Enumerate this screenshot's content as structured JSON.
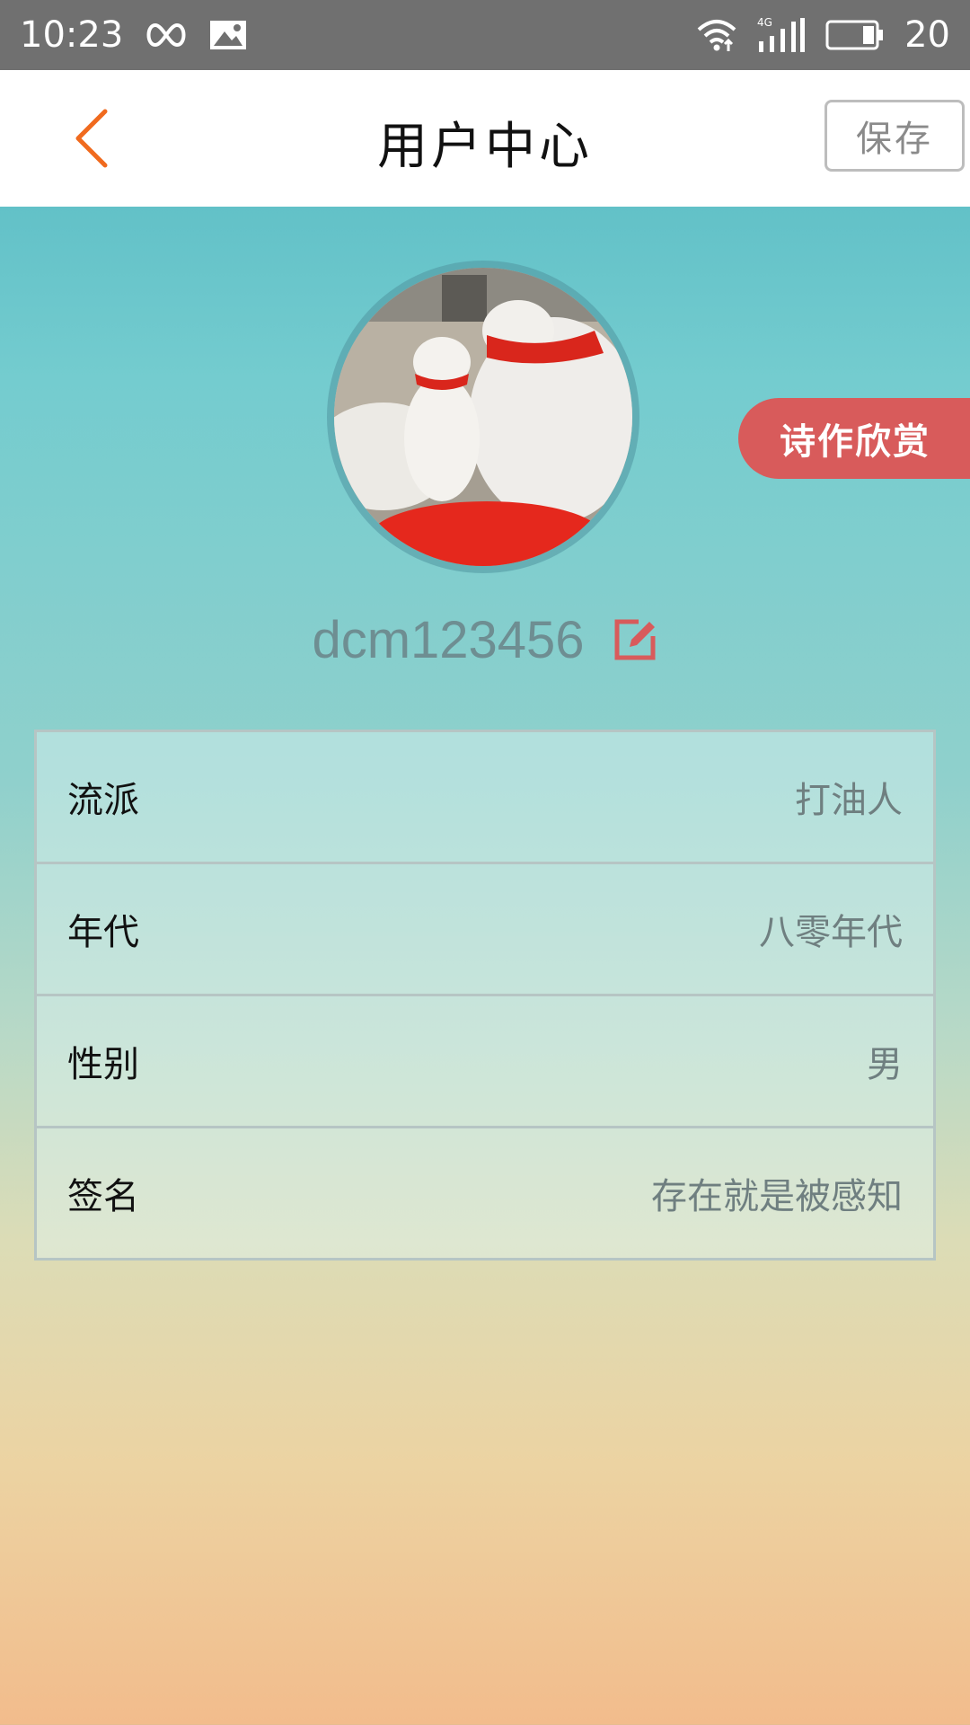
{
  "status_bar": {
    "time": "10:23",
    "battery_level": "20",
    "icons": [
      "infinity-icon",
      "image-icon",
      "wifi-icon",
      "signal-4g-icon",
      "battery-icon"
    ]
  },
  "header": {
    "back_icon": "chevron-left-icon",
    "title": "用户中心",
    "save_label": "保存"
  },
  "profile": {
    "avatar": "polar-bears-photo",
    "poetry_tag": "诗作欣赏",
    "username": "dcm123456",
    "edit_icon": "edit-icon"
  },
  "info": [
    {
      "label": "流派",
      "value": "打油人"
    },
    {
      "label": "年代",
      "value": "八零年代"
    },
    {
      "label": "性别",
      "value": "男"
    },
    {
      "label": "签名",
      "value": "存在就是被感知"
    }
  ],
  "colors": {
    "accent_orange": "#f06a1e",
    "tag_red": "#d85b5b",
    "status_bar": "#707070"
  }
}
